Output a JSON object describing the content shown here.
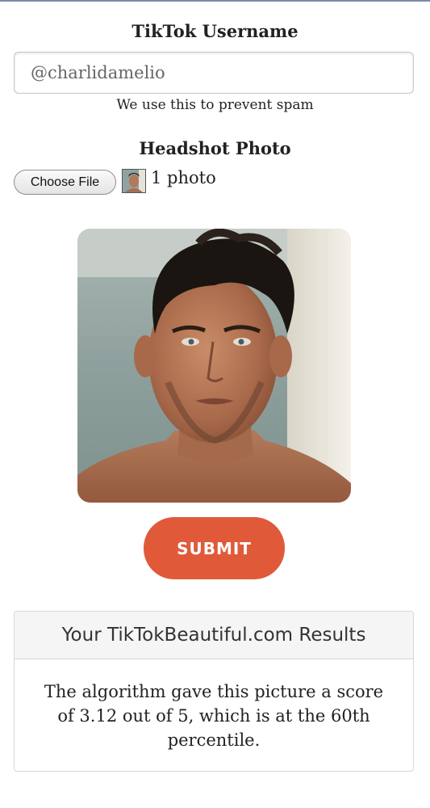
{
  "form": {
    "username_label": "TikTok Username",
    "username_value": "@charlidamelio",
    "username_hint": "We use this to prevent spam",
    "photo_label": "Headshot Photo",
    "choose_file_label": "Choose File",
    "photo_count": "1 photo",
    "submit_label": "SUBMIT"
  },
  "results": {
    "header": "Your TikTokBeautiful.com Results",
    "body": "The algorithm gave this picture a score of 3.12 out of 5, which is at the 60th percentile."
  },
  "colors": {
    "submit_bg": "#e05a3a",
    "results_header_bg": "#f5f5f5"
  },
  "icons": {
    "thumbnail": "headshot-thumbnail-icon"
  }
}
